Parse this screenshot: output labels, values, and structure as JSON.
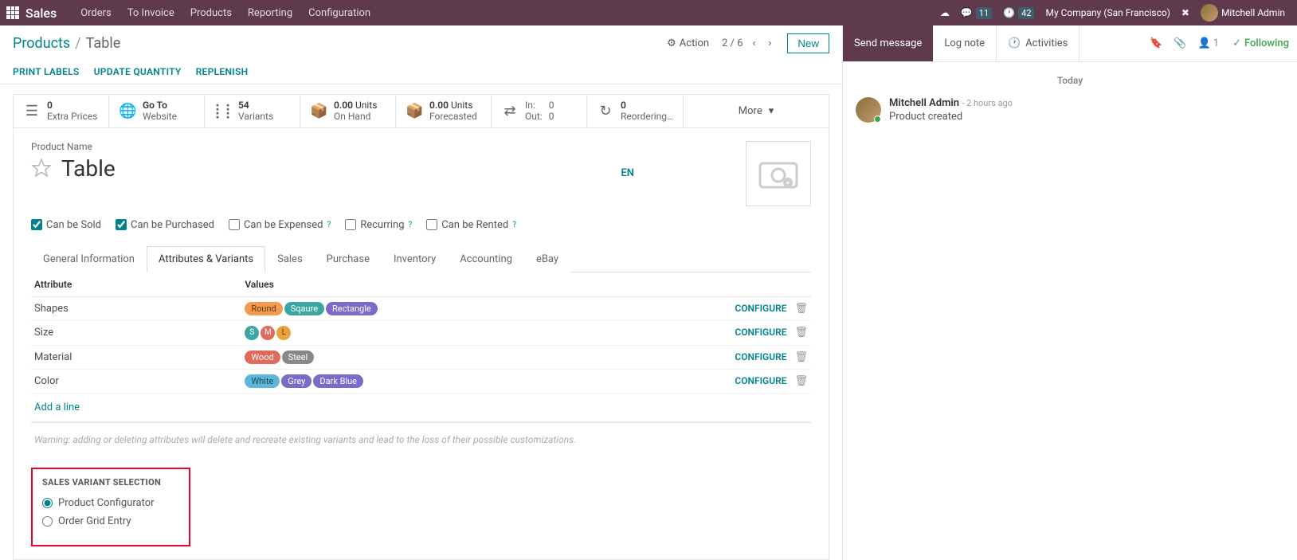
{
  "topbar": {
    "brand": "Sales",
    "menu": [
      "Orders",
      "To Invoice",
      "Products",
      "Reporting",
      "Configuration"
    ],
    "msg_count": "11",
    "clock_count": "42",
    "company": "My Company (San Francisco)",
    "user": "Mitchell Admin"
  },
  "breadcrumb": {
    "parent": "Products",
    "current": "Table",
    "action_label": "Action",
    "pager": "2 / 6",
    "new_label": "New"
  },
  "secondary_actions": [
    "PRINT LABELS",
    "UPDATE QUANTITY",
    "REPLENISH"
  ],
  "stats": {
    "extra_prices": {
      "num": "0",
      "label": "Extra Prices"
    },
    "website": {
      "num": "Go To",
      "label": "Website"
    },
    "variants": {
      "num": "54",
      "label": "Variants"
    },
    "on_hand": {
      "num": "0.00",
      "unit": "Units",
      "label": "On Hand"
    },
    "forecasted": {
      "num": "0.00",
      "unit": "Units",
      "label": "Forecasted"
    },
    "inout": {
      "in_label": "In:",
      "in_val": "0",
      "out_label": "Out:",
      "out_val": "0"
    },
    "reorder": {
      "num": "0",
      "label": "Reordering…"
    },
    "more": "More"
  },
  "product": {
    "name_label": "Product Name",
    "name": "Table",
    "lang": "EN",
    "checkboxes": {
      "sold": "Can be Sold",
      "purchased": "Can be Purchased",
      "expensed": "Can be Expensed",
      "recurring": "Recurring",
      "rented": "Can be Rented"
    }
  },
  "tabs": [
    "General Information",
    "Attributes & Variants",
    "Sales",
    "Purchase",
    "Inventory",
    "Accounting",
    "eBay"
  ],
  "attr_table": {
    "headers": {
      "attr": "Attribute",
      "values": "Values"
    },
    "rows": [
      {
        "attr": "Shapes",
        "values": [
          {
            "t": "Round",
            "c": "orange"
          },
          {
            "t": "Sqaure",
            "c": "teal"
          },
          {
            "t": "Rectangle",
            "c": "purple"
          }
        ]
      },
      {
        "attr": "Size",
        "values": [
          {
            "t": "S",
            "c": "teal",
            "circ": true
          },
          {
            "t": "M",
            "c": "red",
            "circ": true
          },
          {
            "t": "L",
            "c": "amber",
            "circ": true
          }
        ]
      },
      {
        "attr": "Material",
        "values": [
          {
            "t": "Wood",
            "c": "red"
          },
          {
            "t": "Steel",
            "c": "gray"
          }
        ]
      },
      {
        "attr": "Color",
        "values": [
          {
            "t": "White",
            "c": "cyan"
          },
          {
            "t": "Grey",
            "c": "purple"
          },
          {
            "t": "Dark Blue",
            "c": "purple"
          }
        ]
      }
    ],
    "configure": "CONFIGURE",
    "add_line": "Add a line",
    "warning": "Warning: adding or deleting attributes will delete and recreate existing variants and lead to the loss of their possible customizations."
  },
  "variant_selection": {
    "title": "SALES VARIANT SELECTION",
    "opt1": "Product Configurator",
    "opt2": "Order Grid Entry"
  },
  "chatter": {
    "send": "Send message",
    "log": "Log note",
    "activities": "Activities",
    "follower_count": "1",
    "following": "Following",
    "today": "Today",
    "author": "Mitchell Admin",
    "time": "- 2 hours ago",
    "body": "Product created"
  }
}
